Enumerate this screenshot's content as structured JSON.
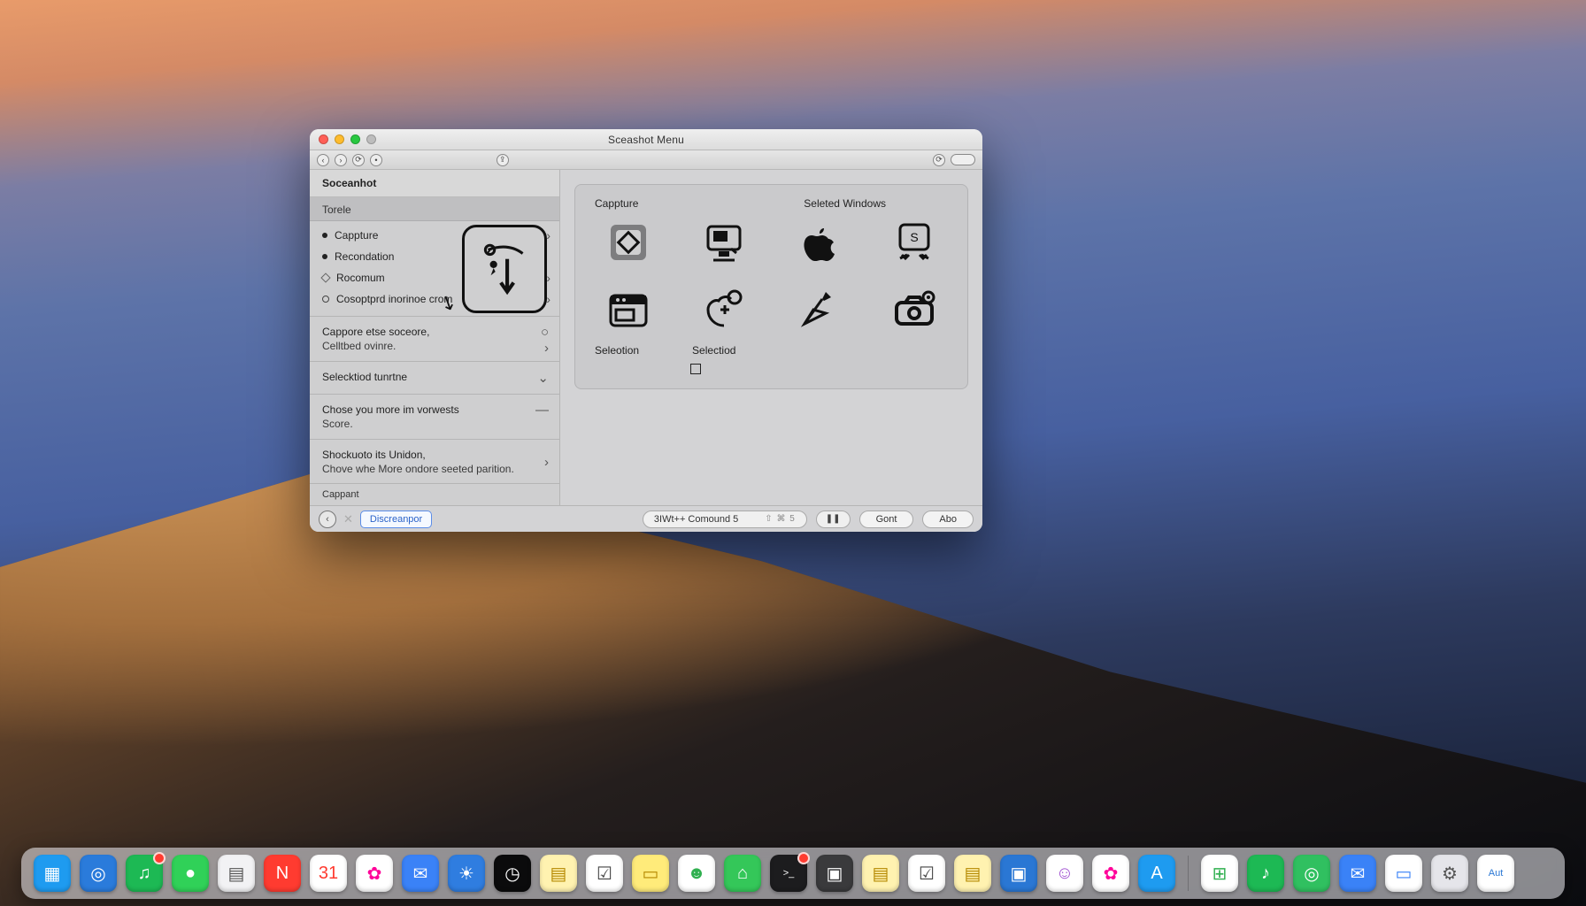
{
  "window": {
    "title": "Sceashot Menu",
    "traffic_colors": {
      "close": "#ff5f57",
      "min": "#febc2e",
      "max": "#28c840",
      "extra": "#bdbdbd"
    }
  },
  "toolbar_right_icon": "⟳",
  "sidebar": {
    "header": "Soceanhot",
    "section": "Torele",
    "items": [
      {
        "label": "Cappture",
        "marker": "dot",
        "chevron": true
      },
      {
        "label": "Recondation",
        "marker": "dot",
        "chevron": false
      },
      {
        "label": "Rocomum",
        "marker": "diam",
        "chevron": true
      },
      {
        "label": "Cosoptprd inorinoe crom",
        "marker": "ring",
        "chevron": true
      }
    ],
    "block1": {
      "title": "Cappore etse soceore,",
      "sub": "Celltbed ovinre.",
      "right": "○"
    },
    "block2": {
      "title": "Selecktiod tunrtne",
      "right": "⌄"
    },
    "block3": {
      "title": "Chose you more im vorwests",
      "sub": "Score.",
      "right": "—"
    },
    "block4": {
      "title": "Shockuoto its Unidon,",
      "sub": "Chove whe More ondore seeted parition.",
      "right": "›"
    },
    "footer": "Cappant"
  },
  "main": {
    "head_left": "Cappture",
    "head_right": "Seleted Windows",
    "row2_label1": "Seleotion",
    "row2_label2": "Selectiod"
  },
  "bottombar": {
    "left_chip": "Discreanpor",
    "shortcut_text": "3IWt++ Comound 5",
    "shortcut_glyphs": "⇧ ⌘ 5",
    "pill_icon": "❚❚",
    "btn1": "Gont",
    "btn2": "Abo"
  },
  "dock": {
    "items": [
      {
        "name": "finder",
        "bg": "#1e9bf0",
        "glyph": "▦"
      },
      {
        "name": "safari",
        "bg": "#2a7bdb",
        "glyph": "◎"
      },
      {
        "name": "spotify",
        "bg": "#1db954",
        "glyph": "♫",
        "badge": true
      },
      {
        "name": "messages",
        "bg": "#30d158",
        "glyph": "●"
      },
      {
        "name": "notes-a",
        "bg": "#f2f2f4",
        "glyph": "▤",
        "fg": "#555"
      },
      {
        "name": "news",
        "bg": "#ff3b30",
        "glyph": "N"
      },
      {
        "name": "calendar",
        "bg": "#ffffff",
        "glyph": "31",
        "fg": "#ff3b30"
      },
      {
        "name": "photos",
        "bg": "#ffffff",
        "glyph": "✿",
        "fg": "#f09"
      },
      {
        "name": "mail",
        "bg": "#3a82f7",
        "glyph": "✉"
      },
      {
        "name": "weather",
        "bg": "#2f7de0",
        "glyph": "☀"
      },
      {
        "name": "clock",
        "bg": "#0b0b0c",
        "glyph": "◷"
      },
      {
        "name": "notes-b",
        "bg": "#fff2b0",
        "glyph": "▤",
        "fg": "#b58900"
      },
      {
        "name": "reminders",
        "bg": "#ffffff",
        "glyph": "☑",
        "fg": "#444"
      },
      {
        "name": "stickies",
        "bg": "#ffeb7a",
        "glyph": "▭",
        "fg": "#b58900"
      },
      {
        "name": "facetime",
        "bg": "#ffffff",
        "glyph": "☻",
        "fg": "#30b050"
      },
      {
        "name": "chat",
        "bg": "#34c759",
        "glyph": "⌂"
      },
      {
        "name": "terminal",
        "bg": "#1c1c1e",
        "glyph": ">_ ",
        "badge": true
      },
      {
        "name": "folder",
        "bg": "#3a3a3c",
        "glyph": "▣"
      },
      {
        "name": "notes-c",
        "bg": "#fff2b0",
        "glyph": "▤",
        "fg": "#b58900"
      },
      {
        "name": "reminders2",
        "bg": "#ffffff",
        "glyph": "☑",
        "fg": "#444"
      },
      {
        "name": "notes-d",
        "bg": "#fff2b0",
        "glyph": "▤",
        "fg": "#b58900"
      },
      {
        "name": "camera",
        "bg": "#2a77d4",
        "glyph": "▣"
      },
      {
        "name": "character",
        "bg": "#ffffff",
        "glyph": "☺",
        "fg": "#a050d0"
      },
      {
        "name": "photos2",
        "bg": "#ffffff",
        "glyph": "✿",
        "fg": "#f09"
      },
      {
        "name": "appstore",
        "bg": "#1e9bf0",
        "glyph": "A"
      }
    ],
    "sep": true,
    "trailing": [
      {
        "name": "launchpad",
        "bg": "#ffffff",
        "glyph": "⊞",
        "fg": "#30b050"
      },
      {
        "name": "music",
        "bg": "#1db954",
        "glyph": "♪"
      },
      {
        "name": "find",
        "bg": "#30c060",
        "glyph": "◎"
      },
      {
        "name": "mail2",
        "bg": "#3a82f7",
        "glyph": "✉"
      },
      {
        "name": "contacts",
        "bg": "#ffffff",
        "glyph": "▭",
        "fg": "#3a82f7"
      },
      {
        "name": "settings",
        "bg": "#e5e5ea",
        "glyph": "⚙",
        "fg": "#555"
      },
      {
        "name": "preview",
        "bg": "#ffffff",
        "glyph": "Aut",
        "fg": "#2a77d4"
      }
    ]
  }
}
